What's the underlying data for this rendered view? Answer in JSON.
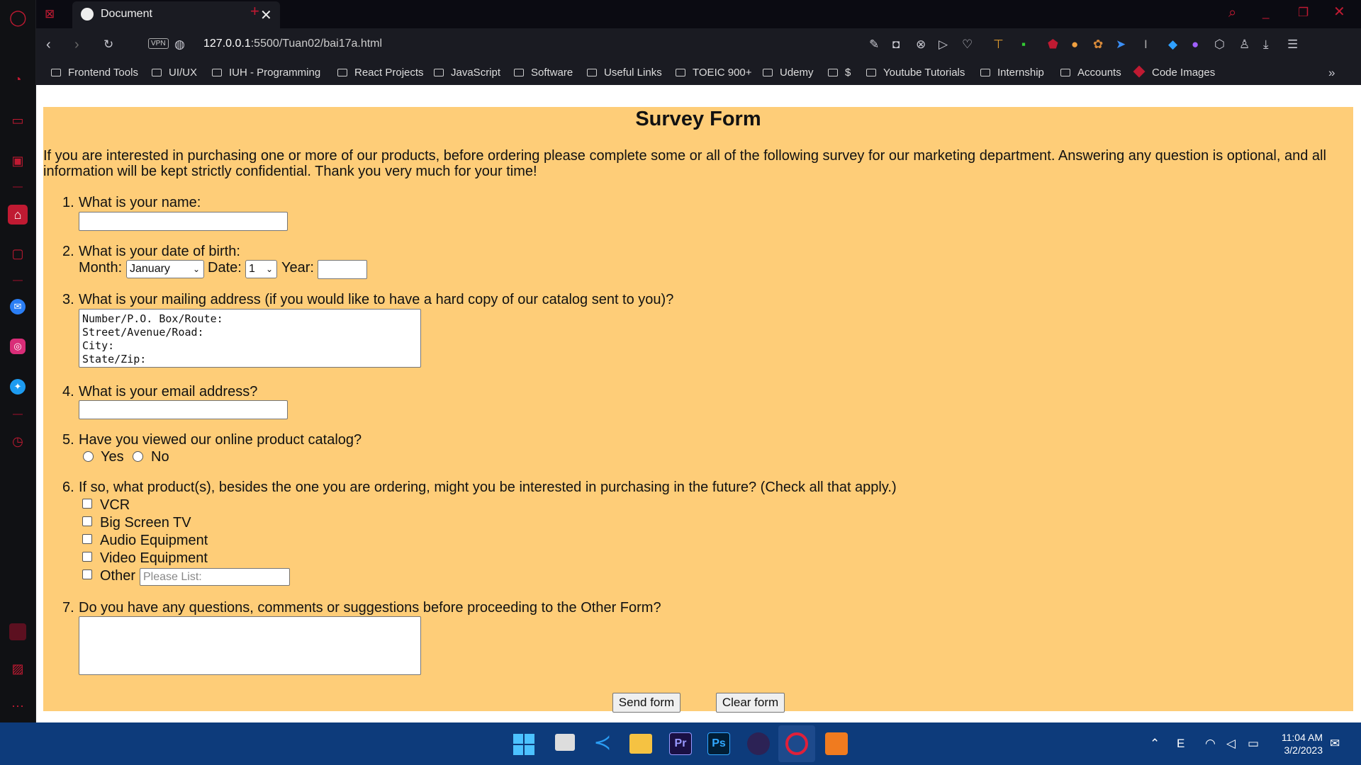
{
  "browser": {
    "tab_title": "Document",
    "url_prefix": "127.0.0.1",
    "url_rest": ":5500/Tuan02/bai17a.html",
    "vpn_label": "VPN",
    "bookmarks": [
      "Frontend Tools",
      "UI/UX",
      "IUH - Programming",
      "React Projects",
      "JavaScript",
      "Software",
      "Useful Links",
      "TOEIC 900+",
      "Udemy",
      "$",
      "Youtube Tutorials",
      "Internship",
      "Accounts",
      "Code Images"
    ]
  },
  "form": {
    "title": "Survey Form",
    "intro": "If you are interested in purchasing one or more of our products, before ordering please complete some or all of the following survey for our marketing department. Answering any question is optional, and all information will be kept strictly confidential. Thank you very much for your time!",
    "q1": "What is your name:",
    "q2": "What is your date of birth:",
    "month_label": "Month:",
    "month_value": "January",
    "date_label": "Date:",
    "date_value": "1",
    "year_label": "Year:",
    "q3": "What is your mailing address (if you would like to have a hard copy of our catalog sent to you)?",
    "address_text": "Number/P.O. Box/Route:\nStreet/Avenue/Road:\nCity:\nState/Zip:",
    "q4": "What is your email address?",
    "q5": "Have you viewed our online product catalog?",
    "yes_label": "Yes",
    "no_label": "No",
    "q6": "If so, what product(s), besides the one you are ordering, might you be interested in purchasing in the future? (Check all that apply.)",
    "products": [
      "VCR",
      "Big Screen TV",
      "Audio Equipment",
      "Video Equipment",
      "Other"
    ],
    "other_placeholder": "Please List:",
    "q7": "Do you have any questions, comments or suggestions before proceeding to the Other Form?",
    "send_label": "Send form",
    "clear_label": "Clear form"
  },
  "taskbar": {
    "time": "11:04 AM",
    "date": "3/2/2023",
    "apps": [
      "windows-start",
      "task-view",
      "vscode",
      "file-explorer",
      "premiere-pro",
      "photoshop",
      "eclipse",
      "opera",
      "pdf-app"
    ]
  },
  "colors": {
    "form_bg": "#fecd78",
    "sidebar_accent": "#c01a32",
    "taskbar_bg": "#0d3b7b"
  }
}
